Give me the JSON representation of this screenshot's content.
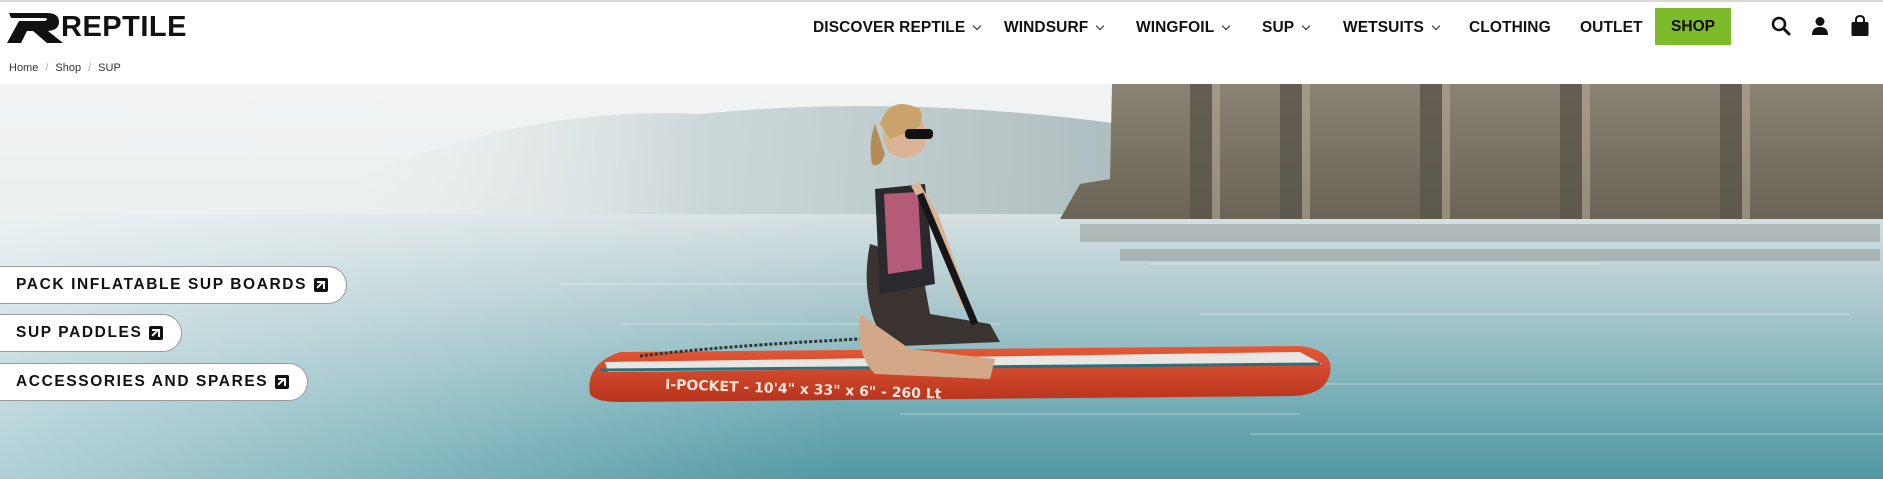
{
  "brand": {
    "name": "REPTILE",
    "accent_color": "#7dbb2b"
  },
  "nav": {
    "items": [
      {
        "label": "DISCOVER REPTILE",
        "has_dropdown": true
      },
      {
        "label": "WINDSURF",
        "has_dropdown": true
      },
      {
        "label": "WINGFOIL",
        "has_dropdown": true
      },
      {
        "label": "SUP",
        "has_dropdown": true
      },
      {
        "label": "WETSUITS",
        "has_dropdown": true
      },
      {
        "label": "CLOTHING",
        "has_dropdown": false
      },
      {
        "label": "OUTLET",
        "has_dropdown": false
      }
    ],
    "shop_label": "SHOP",
    "icons": [
      "search-icon",
      "account-icon",
      "cart-icon"
    ]
  },
  "breadcrumb": [
    "Home",
    "Shop",
    "SUP"
  ],
  "hero": {
    "board_text": "I-POCKET - 10'4\" x 33\" x 6\" - 260 Lt",
    "links": [
      {
        "label": "PACK INFLATABLE SUP BOARDS"
      },
      {
        "label": "SUP PADDLES"
      },
      {
        "label": "ACCESSORIES AND SPARES"
      }
    ]
  }
}
